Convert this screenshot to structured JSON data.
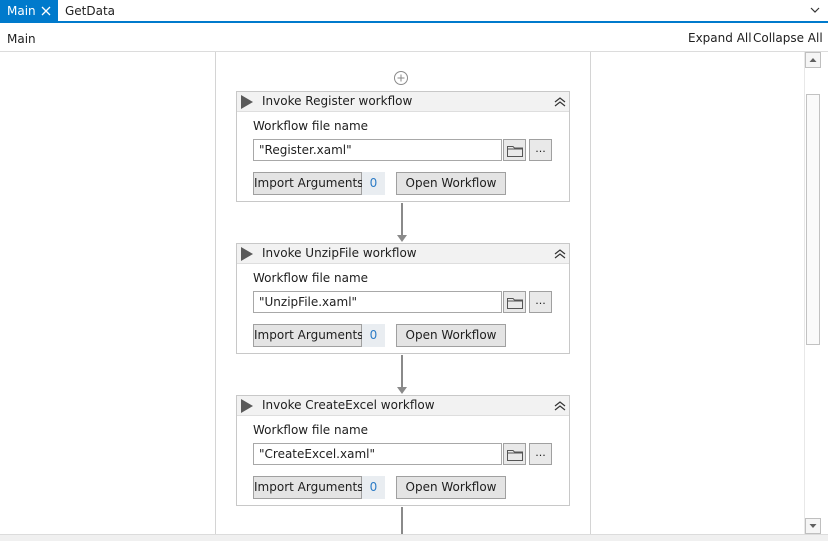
{
  "tabs": [
    {
      "label": "Main",
      "active": true
    },
    {
      "label": "GetData",
      "active": false
    }
  ],
  "breadcrumb": "Main",
  "toolbar": {
    "expand_all": "Expand All",
    "collapse_all": "Collapse All"
  },
  "colors": {
    "accent": "#007acc",
    "count": "#2d7cc6"
  },
  "icons": [
    "close-icon",
    "chevron-down-icon",
    "add-activity-icon",
    "play-icon",
    "collapse-chevron-icon",
    "folder-icon",
    "scroll-up-icon",
    "scroll-down-icon"
  ],
  "activities": [
    {
      "title": "Invoke Register workflow",
      "field_label": "Workflow file name",
      "file_name": "\"Register.xaml\"",
      "browse_label": "...",
      "import_label": "Import Arguments",
      "argument_count": "0",
      "open_label": "Open Workflow"
    },
    {
      "title": "Invoke UnzipFile workflow",
      "field_label": "Workflow file name",
      "file_name": "\"UnzipFile.xaml\"",
      "browse_label": "...",
      "import_label": "Import Arguments",
      "argument_count": "0",
      "open_label": "Open Workflow"
    },
    {
      "title": "Invoke CreateExcel workflow",
      "field_label": "Workflow file name",
      "file_name": "\"CreateExcel.xaml\"",
      "browse_label": "...",
      "import_label": "Import Arguments",
      "argument_count": "0",
      "open_label": "Open Workflow"
    }
  ]
}
